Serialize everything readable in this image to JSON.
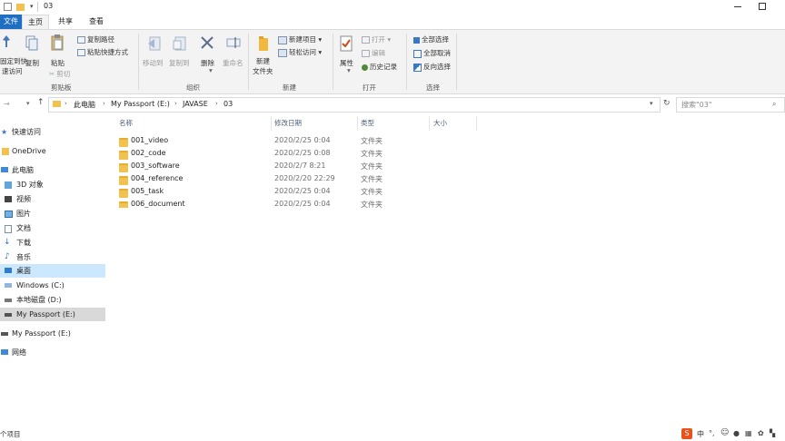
{
  "window": {
    "title": "03"
  },
  "ribbon_tabs": [
    "文件",
    "主页",
    "共享",
    "查看"
  ],
  "clipboard": {
    "pin_label_1": "固定到快",
    "pin_label_2": "速访问",
    "copy": "复制",
    "paste": "粘贴",
    "copy_path": "复制路径",
    "paste_shortcut": "粘贴快捷方式",
    "cut": "剪切",
    "group": "剪贴板"
  },
  "organize": {
    "move_to": "移动到",
    "copy_to": "复制到",
    "delete": "删除",
    "rename": "重命名",
    "group": "组织"
  },
  "new": {
    "new_folder_1": "新建",
    "new_folder_2": "文件夹",
    "new_item": "新建项目",
    "easy_access": "轻松访问",
    "group": "新建"
  },
  "open": {
    "properties": "属性",
    "open": "打开",
    "edit": "编辑",
    "history": "历史记录",
    "group": "打开"
  },
  "select": {
    "select_all": "全部选择",
    "select_none": "全部取消",
    "invert": "反向选择",
    "group": "选择"
  },
  "address": {
    "crumbs": [
      "此电脑",
      "My Passport (E:)",
      "JAVASE",
      "03"
    ],
    "search_placeholder": "搜索\"03\""
  },
  "nav": [
    {
      "label": "快速访问",
      "icon": "star-icon"
    },
    {
      "label": "OneDrive",
      "icon": "folder-icon"
    },
    {
      "label": "此电脑",
      "icon": "computer-icon"
    },
    {
      "label": "3D 对象",
      "icon": "cube-icon"
    },
    {
      "label": "视频",
      "icon": "video-icon"
    },
    {
      "label": "图片",
      "icon": "picture-icon"
    },
    {
      "label": "文档",
      "icon": "document-icon"
    },
    {
      "label": "下载",
      "icon": "download-icon"
    },
    {
      "label": "音乐",
      "icon": "music-icon"
    },
    {
      "label": "桌面",
      "icon": "desktop-icon"
    },
    {
      "label": "Windows (C:)",
      "icon": "drive-icon"
    },
    {
      "label": "本地磁盘 (D:)",
      "icon": "drive-icon"
    },
    {
      "label": "My Passport (E:)",
      "icon": "drive-icon"
    },
    {
      "label": "My Passport (E:)",
      "icon": "drive-icon"
    },
    {
      "label": "网络",
      "icon": "network-icon"
    }
  ],
  "columns": [
    "名称",
    "修改日期",
    "类型",
    "大小"
  ],
  "files": [
    {
      "name": "001_video",
      "date": "2020/2/25 0:04",
      "type": "文件夹"
    },
    {
      "name": "002_code",
      "date": "2020/2/25 0:08",
      "type": "文件夹"
    },
    {
      "name": "003_software",
      "date": "2020/2/7 8:21",
      "type": "文件夹"
    },
    {
      "name": "004_reference",
      "date": "2020/2/20 22:29",
      "type": "文件夹"
    },
    {
      "name": "005_task",
      "date": "2020/2/25 0:04",
      "type": "文件夹"
    },
    {
      "name": "006_document",
      "date": "2020/2/25 0:04",
      "type": "文件夹"
    }
  ],
  "status": {
    "count": "个项目"
  },
  "tray": {
    "ime": "中"
  }
}
